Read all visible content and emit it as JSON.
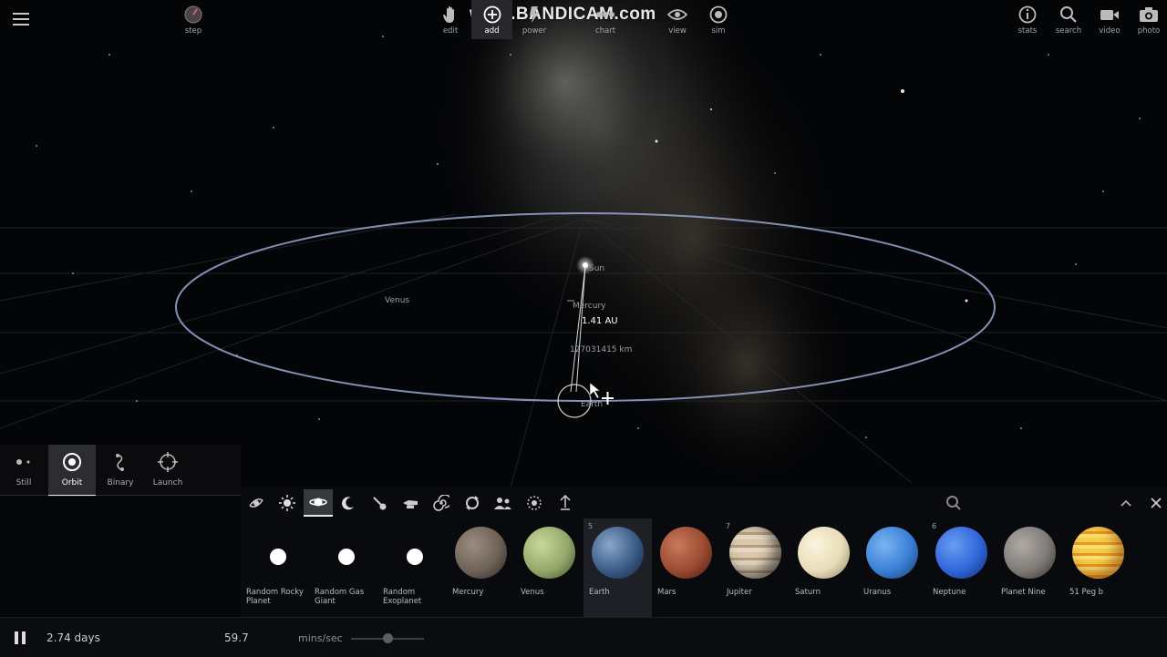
{
  "watermark": "www.BANDICAM.com",
  "scene": {
    "labels": {
      "sun": "Sun",
      "venus": "Venus",
      "mercury": "Mercury",
      "earth": "Earth",
      "distance_au": "1.41 AU",
      "distance_km": "127031415 km"
    }
  },
  "modes": [
    {
      "label": "Still",
      "icon": "still-icon"
    },
    {
      "label": "Orbit",
      "icon": "orbit-icon",
      "active": true
    },
    {
      "label": "Binary",
      "icon": "binary-icon"
    },
    {
      "label": "Launch",
      "icon": "launch-icon"
    }
  ],
  "categories": [
    "galaxy-icon",
    "star-icon",
    "planet-icon",
    "moon-icon",
    "asteroid-icon",
    "spaceship-icon",
    "spiral-icon",
    "rotate-icon",
    "people-icon",
    "ring-icon",
    "anchor-icon"
  ],
  "objects": [
    {
      "name": "Random Rocky Planet",
      "type": "dot"
    },
    {
      "name": "Random Gas Giant",
      "type": "dot"
    },
    {
      "name": "Random Exoplanet",
      "type": "dot"
    },
    {
      "name": "Mercury",
      "color": "#6e6258"
    },
    {
      "name": "Venus",
      "color": "#94a86a"
    },
    {
      "name": "Earth",
      "color": "#3a5c88",
      "count": "5",
      "selected": true
    },
    {
      "name": "Mars",
      "color": "#9a4a30"
    },
    {
      "name": "Jupiter",
      "color": "#c9b59a",
      "count": "7"
    },
    {
      "name": "Saturn",
      "color": "#e8dcb8"
    },
    {
      "name": "Uranus",
      "color": "#3a7fd6"
    },
    {
      "name": "Neptune",
      "color": "#2f66d8",
      "count": "6"
    },
    {
      "name": "Planet Nine",
      "color": "#7e7a76"
    },
    {
      "name": "51 Peg b",
      "color": "#f2b830"
    }
  ],
  "toolbar": {
    "time": "2.74 days",
    "speed_value": "59.7",
    "speed_unit": "mins/sec",
    "step_label": "step",
    "buttons": [
      {
        "label": "edit",
        "icon": "hand-icon"
      },
      {
        "label": "add",
        "icon": "plus-circle-icon",
        "active": true
      },
      {
        "label": "power",
        "icon": "power-icon"
      },
      {
        "label": "chart",
        "icon": "chart-icon"
      },
      {
        "label": "view",
        "icon": "eye-icon"
      },
      {
        "label": "sim",
        "icon": "sim-icon"
      },
      {
        "label": "stats",
        "icon": "info-icon"
      },
      {
        "label": "search",
        "icon": "search-icon"
      },
      {
        "label": "video",
        "icon": "video-icon"
      },
      {
        "label": "photo",
        "icon": "camera-icon"
      }
    ]
  },
  "colors": {
    "orbit": "#9aa8d0",
    "panel": "#0a0b0e",
    "accent": "#ffffff"
  }
}
